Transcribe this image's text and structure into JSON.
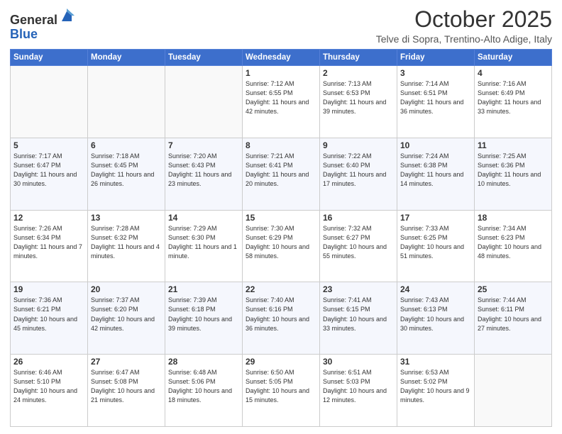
{
  "header": {
    "logo": {
      "line1": "General",
      "line2": "Blue"
    },
    "title": "October 2025",
    "subtitle": "Telve di Sopra, Trentino-Alto Adige, Italy"
  },
  "weekdays": [
    "Sunday",
    "Monday",
    "Tuesday",
    "Wednesday",
    "Thursday",
    "Friday",
    "Saturday"
  ],
  "weeks": [
    [
      {
        "day": "",
        "info": ""
      },
      {
        "day": "",
        "info": ""
      },
      {
        "day": "",
        "info": ""
      },
      {
        "day": "1",
        "info": "Sunrise: 7:12 AM\nSunset: 6:55 PM\nDaylight: 11 hours\nand 42 minutes."
      },
      {
        "day": "2",
        "info": "Sunrise: 7:13 AM\nSunset: 6:53 PM\nDaylight: 11 hours\nand 39 minutes."
      },
      {
        "day": "3",
        "info": "Sunrise: 7:14 AM\nSunset: 6:51 PM\nDaylight: 11 hours\nand 36 minutes."
      },
      {
        "day": "4",
        "info": "Sunrise: 7:16 AM\nSunset: 6:49 PM\nDaylight: 11 hours\nand 33 minutes."
      }
    ],
    [
      {
        "day": "5",
        "info": "Sunrise: 7:17 AM\nSunset: 6:47 PM\nDaylight: 11 hours\nand 30 minutes."
      },
      {
        "day": "6",
        "info": "Sunrise: 7:18 AM\nSunset: 6:45 PM\nDaylight: 11 hours\nand 26 minutes."
      },
      {
        "day": "7",
        "info": "Sunrise: 7:20 AM\nSunset: 6:43 PM\nDaylight: 11 hours\nand 23 minutes."
      },
      {
        "day": "8",
        "info": "Sunrise: 7:21 AM\nSunset: 6:41 PM\nDaylight: 11 hours\nand 20 minutes."
      },
      {
        "day": "9",
        "info": "Sunrise: 7:22 AM\nSunset: 6:40 PM\nDaylight: 11 hours\nand 17 minutes."
      },
      {
        "day": "10",
        "info": "Sunrise: 7:24 AM\nSunset: 6:38 PM\nDaylight: 11 hours\nand 14 minutes."
      },
      {
        "day": "11",
        "info": "Sunrise: 7:25 AM\nSunset: 6:36 PM\nDaylight: 11 hours\nand 10 minutes."
      }
    ],
    [
      {
        "day": "12",
        "info": "Sunrise: 7:26 AM\nSunset: 6:34 PM\nDaylight: 11 hours\nand 7 minutes."
      },
      {
        "day": "13",
        "info": "Sunrise: 7:28 AM\nSunset: 6:32 PM\nDaylight: 11 hours\nand 4 minutes."
      },
      {
        "day": "14",
        "info": "Sunrise: 7:29 AM\nSunset: 6:30 PM\nDaylight: 11 hours\nand 1 minute."
      },
      {
        "day": "15",
        "info": "Sunrise: 7:30 AM\nSunset: 6:29 PM\nDaylight: 10 hours\nand 58 minutes."
      },
      {
        "day": "16",
        "info": "Sunrise: 7:32 AM\nSunset: 6:27 PM\nDaylight: 10 hours\nand 55 minutes."
      },
      {
        "day": "17",
        "info": "Sunrise: 7:33 AM\nSunset: 6:25 PM\nDaylight: 10 hours\nand 51 minutes."
      },
      {
        "day": "18",
        "info": "Sunrise: 7:34 AM\nSunset: 6:23 PM\nDaylight: 10 hours\nand 48 minutes."
      }
    ],
    [
      {
        "day": "19",
        "info": "Sunrise: 7:36 AM\nSunset: 6:21 PM\nDaylight: 10 hours\nand 45 minutes."
      },
      {
        "day": "20",
        "info": "Sunrise: 7:37 AM\nSunset: 6:20 PM\nDaylight: 10 hours\nand 42 minutes."
      },
      {
        "day": "21",
        "info": "Sunrise: 7:39 AM\nSunset: 6:18 PM\nDaylight: 10 hours\nand 39 minutes."
      },
      {
        "day": "22",
        "info": "Sunrise: 7:40 AM\nSunset: 6:16 PM\nDaylight: 10 hours\nand 36 minutes."
      },
      {
        "day": "23",
        "info": "Sunrise: 7:41 AM\nSunset: 6:15 PM\nDaylight: 10 hours\nand 33 minutes."
      },
      {
        "day": "24",
        "info": "Sunrise: 7:43 AM\nSunset: 6:13 PM\nDaylight: 10 hours\nand 30 minutes."
      },
      {
        "day": "25",
        "info": "Sunrise: 7:44 AM\nSunset: 6:11 PM\nDaylight: 10 hours\nand 27 minutes."
      }
    ],
    [
      {
        "day": "26",
        "info": "Sunrise: 6:46 AM\nSunset: 5:10 PM\nDaylight: 10 hours\nand 24 minutes."
      },
      {
        "day": "27",
        "info": "Sunrise: 6:47 AM\nSunset: 5:08 PM\nDaylight: 10 hours\nand 21 minutes."
      },
      {
        "day": "28",
        "info": "Sunrise: 6:48 AM\nSunset: 5:06 PM\nDaylight: 10 hours\nand 18 minutes."
      },
      {
        "day": "29",
        "info": "Sunrise: 6:50 AM\nSunset: 5:05 PM\nDaylight: 10 hours\nand 15 minutes."
      },
      {
        "day": "30",
        "info": "Sunrise: 6:51 AM\nSunset: 5:03 PM\nDaylight: 10 hours\nand 12 minutes."
      },
      {
        "day": "31",
        "info": "Sunrise: 6:53 AM\nSunset: 5:02 PM\nDaylight: 10 hours\nand 9 minutes."
      },
      {
        "day": "",
        "info": ""
      }
    ]
  ]
}
